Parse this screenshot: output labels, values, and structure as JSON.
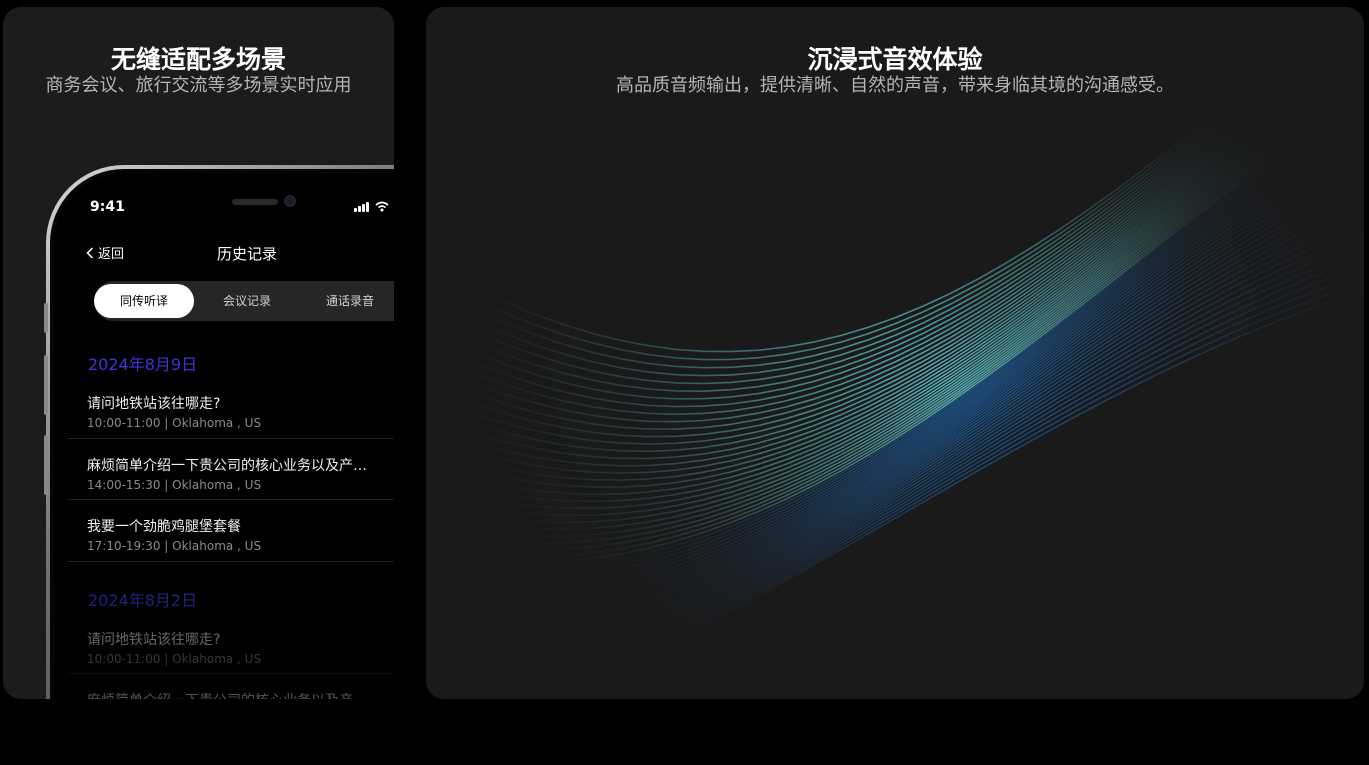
{
  "left_card": {
    "title": "无缝适配多场景",
    "subtitle": "商务会议、旅行交流等多场景实时应用"
  },
  "right_card": {
    "title": "沉浸式音效体验",
    "subtitle": "高品质音频输出，提供清晰、自然的声音，带来身临其境的沟通感受。"
  },
  "phone": {
    "status_time": "9:41",
    "back_label": "返回",
    "page_title": "历史记录",
    "tabs": [
      {
        "label": "同传听译",
        "active": true
      },
      {
        "label": "会议记录",
        "active": false
      },
      {
        "label": "通话录音",
        "active": false
      }
    ],
    "groups": [
      {
        "date": "2024年8月9日",
        "items": [
          {
            "title": "请问地铁站该往哪走?",
            "meta": "10:00-11:00 | Oklahoma , US"
          },
          {
            "title": "麻烦简单介绍一下贵公司的核心业务以及产…",
            "meta": "14:00-15:30 | Oklahoma , US"
          },
          {
            "title": "我要一个劲脆鸡腿堡套餐",
            "meta": "17:10-19:30 | Oklahoma , US"
          }
        ]
      },
      {
        "date": "2024年8月2日",
        "items": [
          {
            "title": "请问地铁站该往哪走?",
            "meta": "10:00-11:00 | Oklahoma , US"
          },
          {
            "title": "麻烦简单介绍一下贵公司的核心业务以及产…",
            "meta": ""
          }
        ]
      }
    ]
  },
  "colors": {
    "date_accent": "#3a36d8",
    "wave_core": "#6fe6f2",
    "wave_edge": "#1f6fbf"
  },
  "icons": {
    "back": "chevron-left-icon",
    "signal": "signal-bars-icon",
    "wifi": "wifi-icon"
  }
}
